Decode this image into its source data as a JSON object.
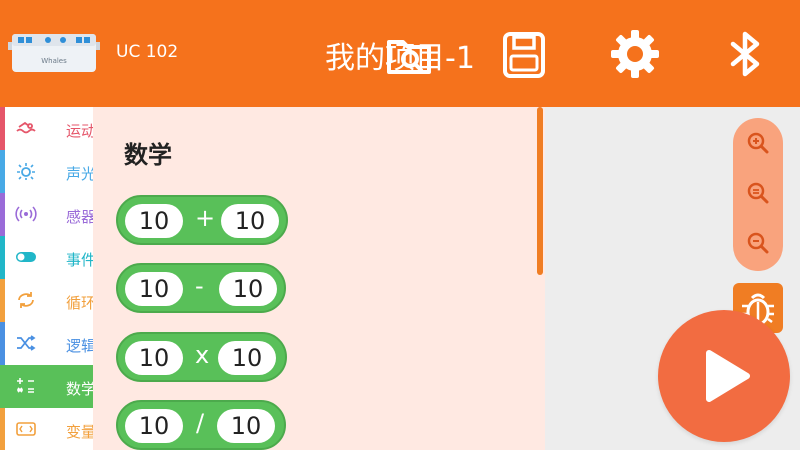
{
  "header": {
    "device_name": "UC 102",
    "robot_brand": "Whales",
    "project_title": "我的项目-1",
    "icons": [
      "folder-search-icon",
      "save-icon",
      "gear-icon",
      "bluetooth-icon"
    ]
  },
  "categories": [
    {
      "label": "运动",
      "color": "#e5566a",
      "icon": "swimmer-icon"
    },
    {
      "label": "声光",
      "color": "#48a9e6",
      "icon": "sun-icon"
    },
    {
      "label": "感器",
      "color": "#9a6bd8",
      "icon": "signal-icon"
    },
    {
      "label": "事件",
      "color": "#21b6c8",
      "icon": "toggle-icon"
    },
    {
      "label": "循环",
      "color": "#f2a03d",
      "icon": "loop-icon"
    },
    {
      "label": "逻辑",
      "color": "#4a90e2",
      "icon": "shuffle-icon"
    },
    {
      "label": "数学",
      "color": "#59c059",
      "icon": "math-icon",
      "active": true
    },
    {
      "label": "变量",
      "color": "#f2a03d",
      "icon": "variable-icon"
    }
  ],
  "flyout": {
    "title": "数学",
    "blocks": [
      {
        "left": "10",
        "op": "+",
        "right": "10"
      },
      {
        "left": "10",
        "op": "-",
        "right": "10"
      },
      {
        "left": "10",
        "op": "x",
        "right": "10"
      },
      {
        "left": "10",
        "op": "/",
        "right": "10"
      }
    ]
  },
  "colors": {
    "header": "#f5721c",
    "math_block": "#59c059",
    "flyout_bg": "#ffe9e2",
    "run_button": "#f26c41"
  }
}
